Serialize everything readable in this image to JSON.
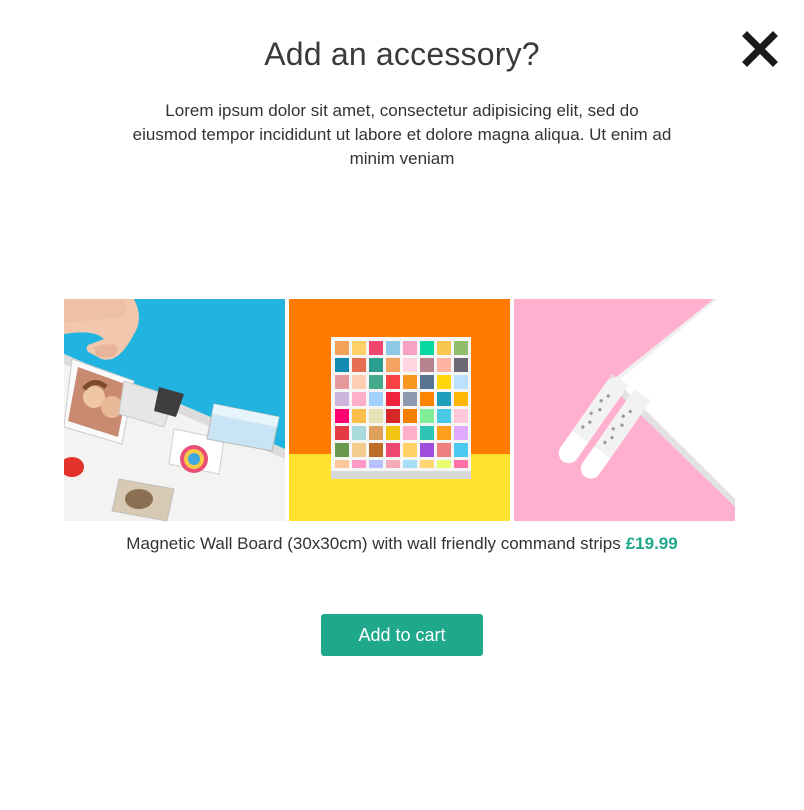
{
  "modal": {
    "title": "Add an accessory?",
    "description": "Lorem ipsum dolor sit amet, consectetur adipisicing elit, sed do eiusmod tempor incididunt ut labore et dolore magna aliqua. Ut enim ad minim veniam",
    "close_icon": "close-icon"
  },
  "product": {
    "name": "Magnetic Wall Board (30x30cm) with wall friendly command strips",
    "price": "£19.99",
    "add_to_cart_label": "Add to cart"
  },
  "gallery": {
    "images": [
      {
        "name": "hand-placing-magnets-photo"
      },
      {
        "name": "magnetic-wall-board-photo"
      },
      {
        "name": "command-strips-photo"
      }
    ]
  },
  "colors": {
    "accent": "#1fa88b",
    "title_text": "#3a3a3a",
    "body_text": "#333333",
    "photo1_bg": "#22b4e0",
    "photo2_top": "#ff7a00",
    "photo2_bottom": "#ffe22e",
    "photo3_bg": "#ffb0cf"
  }
}
